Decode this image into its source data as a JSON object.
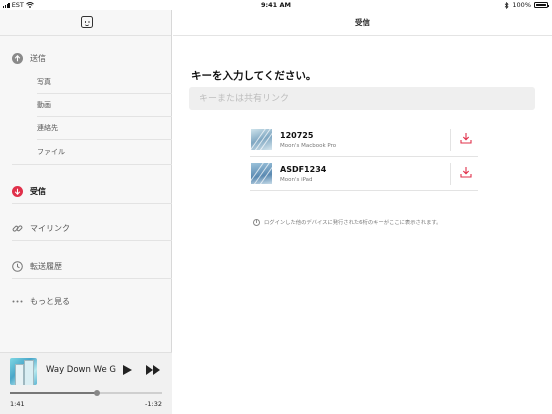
{
  "status": {
    "carrier": "EST",
    "time": "9:41 AM",
    "battery": "100%"
  },
  "sidebar": {
    "items": [
      {
        "label": "送信",
        "sub": [
          "写真",
          "動画",
          "連絡先",
          "ファイル"
        ]
      },
      {
        "label": "受信"
      },
      {
        "label": "マイリンク"
      },
      {
        "label": "転送履歴"
      },
      {
        "label": "もっと見る"
      }
    ]
  },
  "player": {
    "track": "Way Down We Go",
    "elapsed": "1:41",
    "remaining": "-1:32",
    "progress": 0.57
  },
  "main": {
    "title": "受信",
    "heading": "キーを入力してください。",
    "input_placeholder": "キーまたは共有リンク",
    "devices": [
      {
        "name": "120725",
        "device": "Moon's Macbook Pro"
      },
      {
        "name": "ASDF1234",
        "device": "Moon's iPad"
      }
    ],
    "info": "ログインした他のデバイスに発行された6桁のキーがここに表示されます。"
  },
  "colors": {
    "accent": "#e0304a",
    "send_icon": "#8a8a8a"
  }
}
